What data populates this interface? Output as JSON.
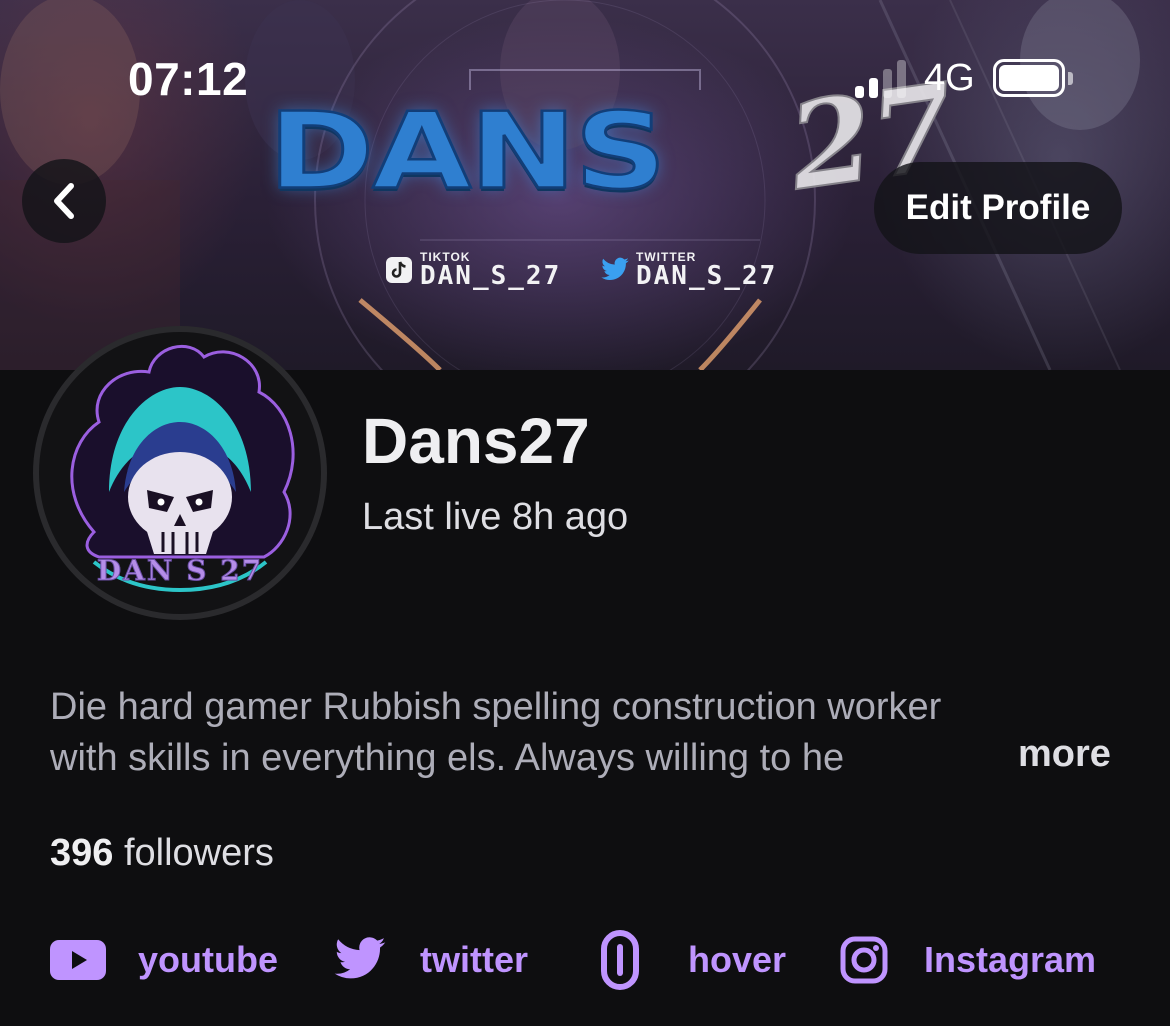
{
  "status_bar": {
    "time": "07:12",
    "network": "4G",
    "signal_bars_active": 2,
    "signal_bars_total": 4,
    "battery_level": 1.0
  },
  "banner": {
    "logo_text": "DANS",
    "logo_number": "27",
    "tiktok_small": "TIKTOK",
    "tiktok_handle": "DAN_S_27",
    "twitter_small": "TWITTER",
    "twitter_handle": "DAN_S_27"
  },
  "nav": {
    "back_icon": "chevron-left-icon",
    "edit_profile_label": "Edit Profile"
  },
  "profile": {
    "avatar_caption": "DAN S 27",
    "name": "Dans27",
    "last_live": "Last live 8h ago",
    "bio_line1": "Die hard gamer Rubbish spelling construction worker",
    "bio_line2": "with skills in everything els. Always willing to he",
    "more_label": "more",
    "followers_count": "396",
    "followers_label": "followers"
  },
  "links": [
    {
      "label": "youtube",
      "icon": "youtube-icon"
    },
    {
      "label": "twitter",
      "icon": "twitter-icon"
    },
    {
      "label": "hover",
      "icon": "link-icon"
    },
    {
      "label": "Instagram",
      "icon": "instagram-icon"
    }
  ],
  "colors": {
    "background": "#0e0e10",
    "accent": "#bf94ff",
    "text_primary": "#efeff1",
    "text_secondary": "#adadb8"
  }
}
